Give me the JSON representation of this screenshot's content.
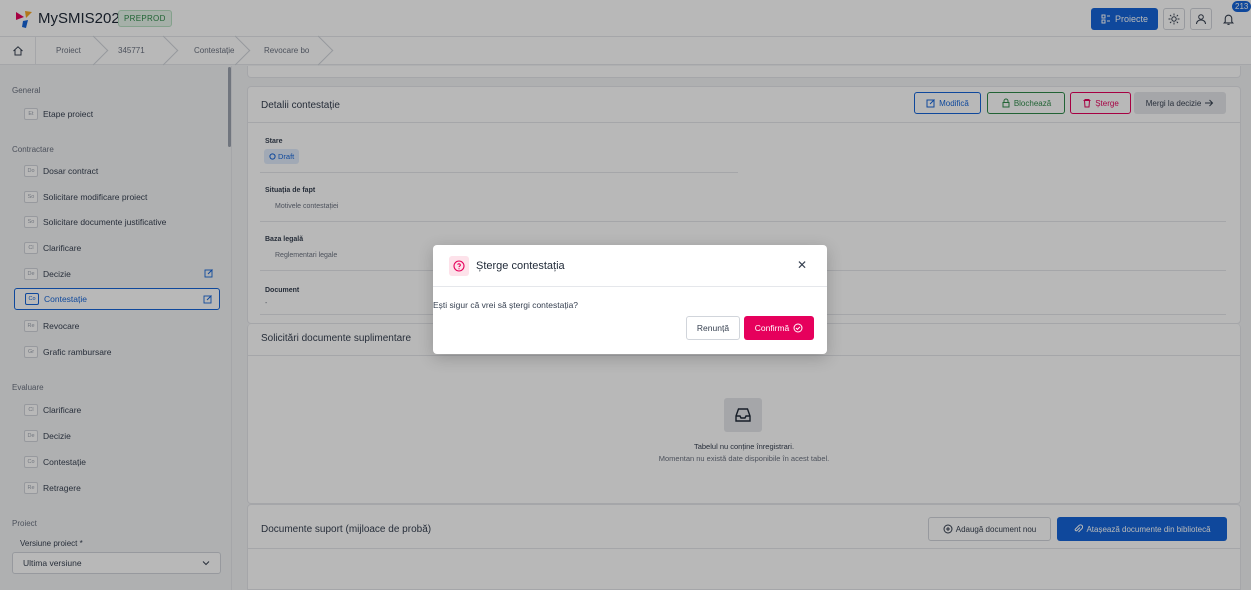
{
  "app": {
    "title": "MySMIS2021",
    "env": "PREPROD"
  },
  "topbar": {
    "projects_label": "Proiecte",
    "notifications_count": "213"
  },
  "breadcrumb": [
    "Proiect",
    "345771",
    "Contestație",
    "Revocare bo"
  ],
  "sidebar": {
    "sections": [
      "General",
      "Contractare",
      "Evaluare",
      "Proiect"
    ],
    "general_items": [
      {
        "abbr": "Et",
        "label": "Etape proiect"
      }
    ],
    "contractare_items": [
      {
        "abbr": "Do",
        "label": "Dosar contract"
      },
      {
        "abbr": "So",
        "label": "Solicitare modificare proiect"
      },
      {
        "abbr": "So",
        "label": "Solicitare documente justificative"
      },
      {
        "abbr": "Cl",
        "label": "Clarificare"
      },
      {
        "abbr": "De",
        "label": "Decizie"
      },
      {
        "abbr": "Co",
        "label": "Contestație"
      },
      {
        "abbr": "Re",
        "label": "Revocare"
      },
      {
        "abbr": "Gr",
        "label": "Grafic rambursare"
      }
    ],
    "evaluare_items": [
      {
        "abbr": "Cl",
        "label": "Clarificare"
      },
      {
        "abbr": "De",
        "label": "Decizie"
      },
      {
        "abbr": "Co",
        "label": "Contestație"
      },
      {
        "abbr": "Re",
        "label": "Retragere"
      }
    ],
    "version_label": "Versiune proiect *",
    "version_value": "Ultima versiune"
  },
  "details": {
    "title": "Detalii contestație",
    "buttons": {
      "edit": "Modifică",
      "lock": "Blochează",
      "delete": "Șterge",
      "goto": "Mergi la decizie"
    },
    "status_label": "Stare",
    "status_value": "Draft",
    "fact_label": "Situația de fapt",
    "fact_value": "Motivele contestației",
    "legal_label": "Baza legală",
    "legal_value": "Reglementari legale",
    "document_label": "Document",
    "document_value": "-"
  },
  "requests": {
    "title": "Solicitări documente suplimentare",
    "empty_title": "Tabelul nu conține înregistrari.",
    "empty_subtitle": "Momentan nu există date disponibile în acest tabel."
  },
  "support": {
    "title": "Documente suport (mijloace de probă)",
    "add_label": "Adaugă document nou",
    "attach_label": "Atașează documente din bibliotecă"
  },
  "modal": {
    "title": "Șterge contestația",
    "message": "Ești sigur că vrei să ștergi contestația?",
    "cancel": "Renunță",
    "confirm": "Confirmă"
  },
  "colors": {
    "primary": "#1565d8",
    "danger": "#e6005c",
    "success": "#2f8a4a"
  }
}
